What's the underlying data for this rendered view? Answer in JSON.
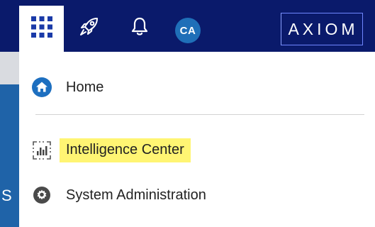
{
  "topbar": {
    "logo_text": "AXIOM",
    "avatar_initials": "CA",
    "icons": [
      "app-grid-icon",
      "rocket-icon",
      "bell-icon"
    ],
    "colors": {
      "bar": "#0a1a6b",
      "avatar": "#1f6fb8",
      "logo_border": "#6f86ff"
    }
  },
  "background": {
    "edge_letter": "S"
  },
  "menu": {
    "items": [
      {
        "label": "Home",
        "icon": "home-icon"
      },
      {
        "label": "Intelligence Center",
        "icon": "dashboard-icon",
        "highlighted": true
      },
      {
        "label": "System Administration",
        "icon": "gear-icon"
      }
    ],
    "highlight_color": "#fff573"
  }
}
